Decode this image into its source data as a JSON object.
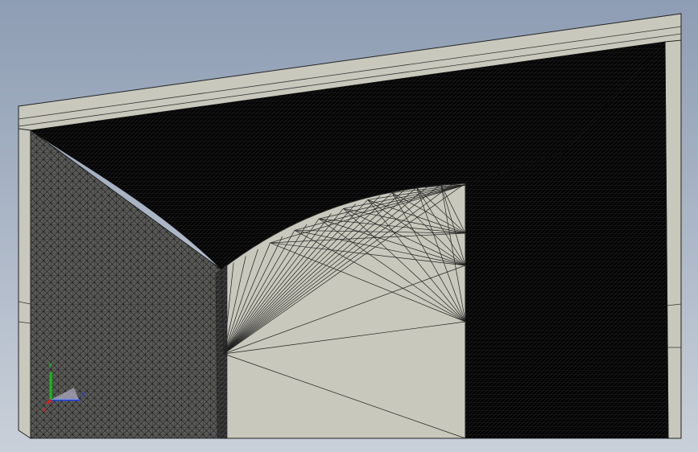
{
  "viewport": {
    "background_top": "#8e9db4",
    "background_bottom": "#c9d0d9",
    "model_face_color": "#c8c8bc",
    "mesh_line_color": "#111111",
    "dark_mesh_color": "#060606"
  },
  "triad": {
    "x_label": "x",
    "y_label": "y",
    "z_label": "z",
    "x_color": "#e02020",
    "y_color": "#10c010",
    "z_color": "#2040e0"
  }
}
